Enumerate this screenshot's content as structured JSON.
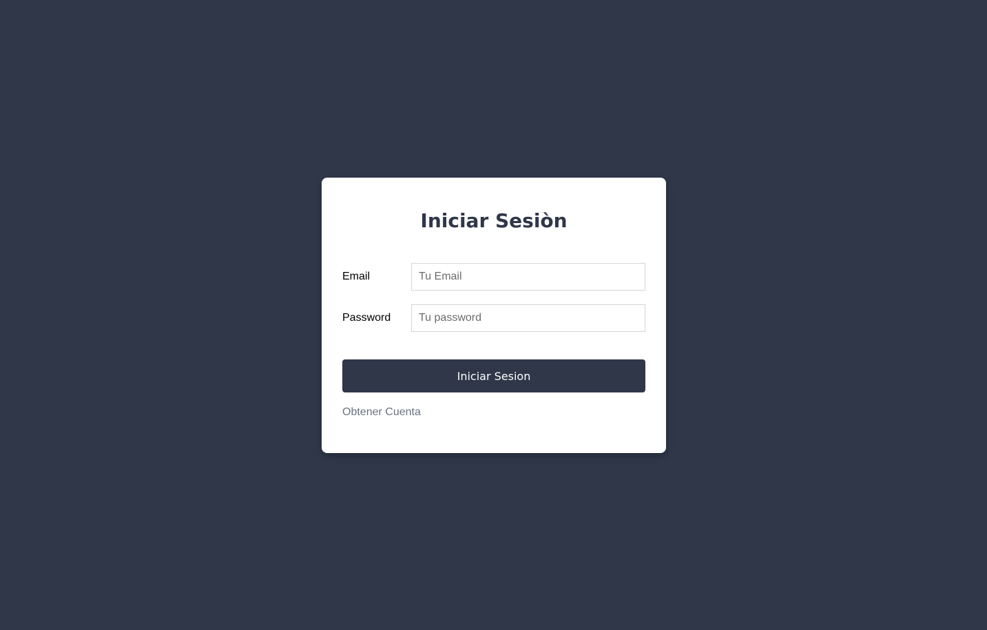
{
  "login": {
    "title": "Iniciar Sesiòn",
    "email_label": "Email",
    "email_placeholder": "Tu Email",
    "password_label": "Password",
    "password_placeholder": "Tu password",
    "submit_label": "Iniciar Sesion",
    "register_link": "Obtener Cuenta"
  },
  "colors": {
    "background": "#2f3749",
    "card": "#ffffff",
    "button": "#2f3749",
    "link": "#6b7280"
  }
}
